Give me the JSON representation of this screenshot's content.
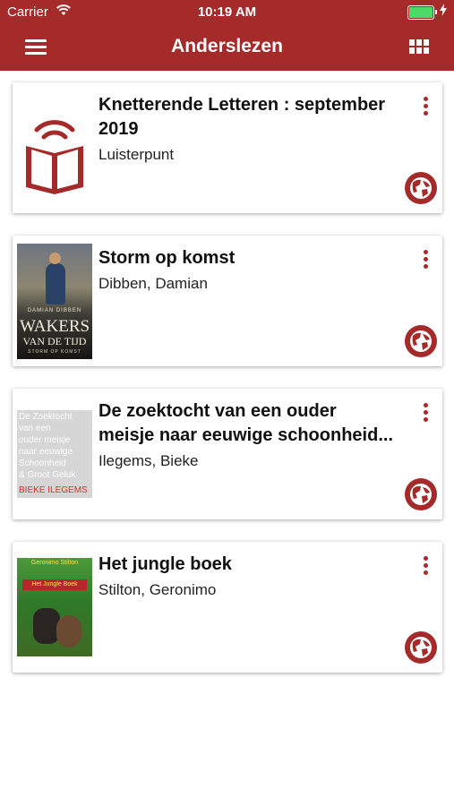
{
  "status_bar": {
    "carrier": "Carrier",
    "time": "10:19 AM",
    "battery_level": 1.0
  },
  "nav": {
    "title": "Anderslezen",
    "menu_icon": "hamburger-menu-icon",
    "view_icon": "grid-view-icon"
  },
  "colors": {
    "brand": "#a52a2a",
    "battery": "#4cd964"
  },
  "books": [
    {
      "title": "Knetterende Letteren : september 2019",
      "author": "Luisterpunt",
      "cover": "audio-book-icon"
    },
    {
      "title": "Storm op komst",
      "author": "Dibben, Damian",
      "cover": "book-cover",
      "cover_text": {
        "author": "DAMIAN DIBBEN",
        "title_line1": "WAKERS",
        "title_line2": "VAN DE TIJD",
        "subtitle": "STORM OP KOMST"
      }
    },
    {
      "title": "De zoektocht van een ouder meisje naar eeuwige schoonheid...",
      "author": "Ilegems, Bieke",
      "cover": "book-cover",
      "cover_text": {
        "lines": [
          "De Zoektocht",
          "van een",
          "ouder meisje",
          "naar eeuwige",
          "Schoonheid",
          "& Groot Geluk"
        ],
        "author": "BIEKE ILEGEMS"
      }
    },
    {
      "title": "Het jungle boek",
      "author": "Stilton, Geronimo",
      "cover": "book-cover",
      "cover_text": {
        "author": "Geronimo Stilton",
        "title": "Het Jungle Boek"
      }
    }
  ]
}
